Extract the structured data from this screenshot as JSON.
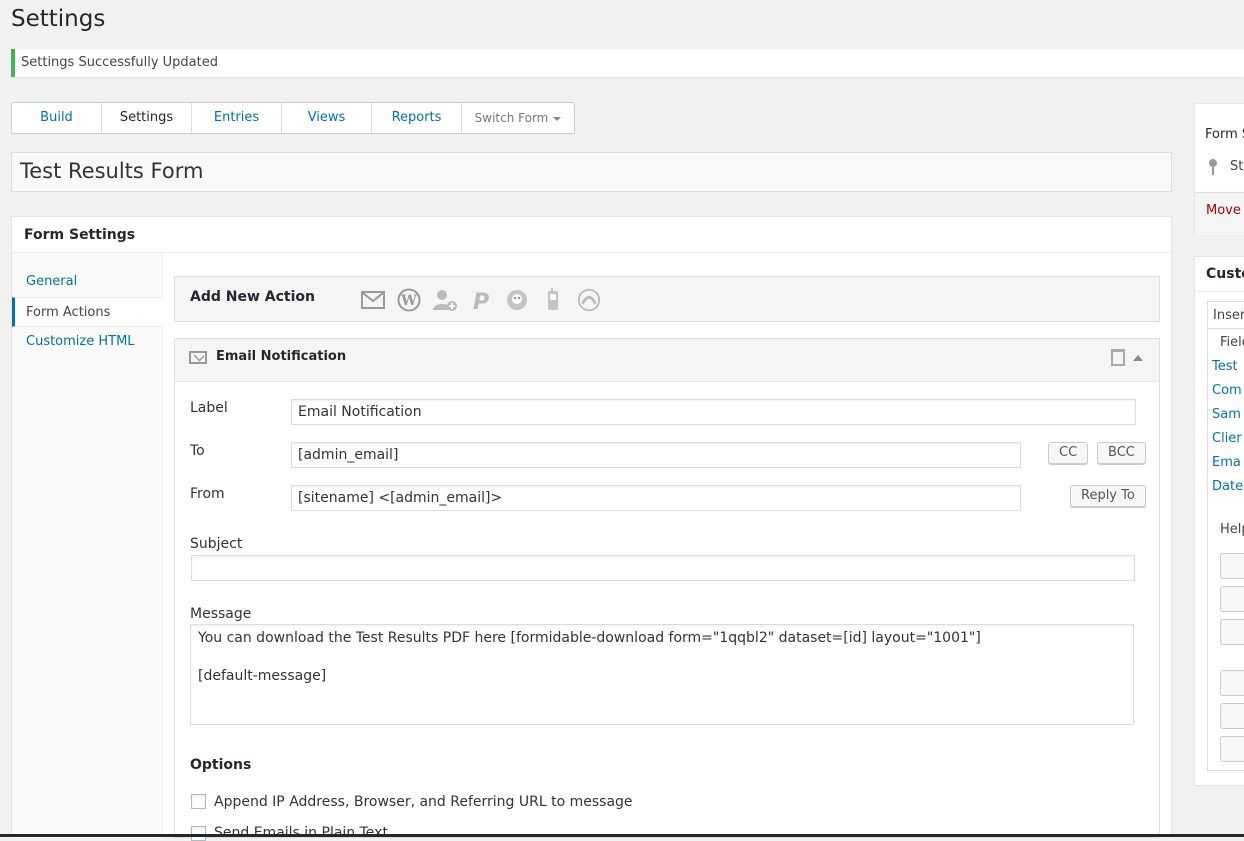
{
  "page": {
    "title": "Settings"
  },
  "notice": {
    "text": "Settings Successfully Updated",
    "color": "#46b450"
  },
  "tabs": [
    {
      "label": "Build"
    },
    {
      "label": "Settings"
    },
    {
      "label": "Entries"
    },
    {
      "label": "Views"
    },
    {
      "label": "Reports"
    },
    {
      "label": "Switch Form"
    }
  ],
  "form": {
    "name": "Test Results Form"
  },
  "panel": {
    "header": "Form Settings",
    "nav": [
      {
        "label": "General"
      },
      {
        "label": "Form Actions"
      },
      {
        "label": "Customize HTML"
      }
    ]
  },
  "add_action": {
    "label": "Add New Action",
    "icons": [
      "email-icon",
      "wordpress-icon",
      "register-user-icon",
      "paypal-icon",
      "mailchimp-icon",
      "sms-icon",
      "aweber-icon"
    ]
  },
  "email_action": {
    "title": "Email Notification",
    "fields": {
      "label_label": "Label",
      "label_value": "Email Notification",
      "to_label": "To",
      "to_value": "[admin_email]",
      "cc_button": "CC",
      "bcc_button": "BCC",
      "from_label": "From",
      "from_value": "[sitename] <[admin_email]>",
      "reply_to_button": "Reply To",
      "subject_label": "Subject",
      "subject_value": "",
      "message_label": "Message",
      "message_line1": "You can download the Test Results PDF here [formidable-download form=\"1qqbl2\" dataset=[id] layout=\"1001\"]",
      "message_line2": "[default-message]"
    },
    "options": {
      "heading": "Options",
      "option1": "Append IP Address, Browser, and Referring URL to message",
      "option2": "Send Emails in Plain Text"
    }
  },
  "sidebar": {
    "box1": {
      "title": "Form S",
      "status": "Sta",
      "move": "Move"
    },
    "box2": {
      "title": "Custo",
      "tab": "Insert",
      "fields_heading": "Field",
      "fields": [
        "Test",
        "Com",
        "Sam",
        "Clier",
        "Ema",
        "Date"
      ],
      "helpers_heading": "Help"
    }
  }
}
